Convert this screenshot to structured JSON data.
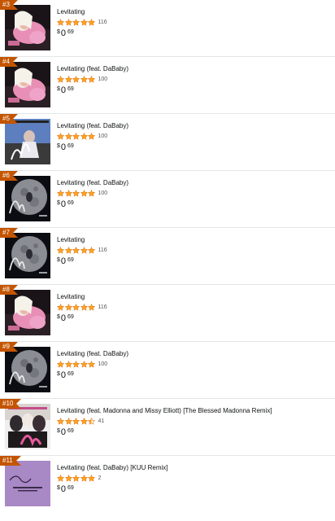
{
  "colors": {
    "rank_badge": "#c45500",
    "star": "#ffa41c",
    "star_stroke": "#de7921",
    "divider": "#e3e6e6"
  },
  "items": [
    {
      "rank": "#3",
      "title": "Levitating",
      "stars": 5,
      "reviews": "116",
      "currency": "$",
      "price_whole": "0",
      "price_fraction": "69",
      "cover": "pink"
    },
    {
      "rank": "#4",
      "title": "Levitating (feat. DaBaby)",
      "stars": 5,
      "reviews": "100",
      "currency": "$",
      "price_whole": "0",
      "price_fraction": "69",
      "cover": "pink"
    },
    {
      "rank": "#5",
      "title": "Levitating (feat. DaBaby)",
      "stars": 5,
      "reviews": "100",
      "currency": "$",
      "price_whole": "0",
      "price_fraction": "69",
      "cover": "script"
    },
    {
      "rank": "#6",
      "title": "Levitating (feat. DaBaby)",
      "stars": 5,
      "reviews": "100",
      "currency": "$",
      "price_whole": "0",
      "price_fraction": "69",
      "cover": "moon"
    },
    {
      "rank": "#7",
      "title": "Levitating",
      "stars": 5,
      "reviews": "116",
      "currency": "$",
      "price_whole": "0",
      "price_fraction": "69",
      "cover": "moon"
    },
    {
      "rank": "#8",
      "title": "Levitating",
      "stars": 5,
      "reviews": "116",
      "currency": "$",
      "price_whole": "0",
      "price_fraction": "69",
      "cover": "pink"
    },
    {
      "rank": "#9",
      "title": "Levitating (feat. DaBaby)",
      "stars": 5,
      "reviews": "100",
      "currency": "$",
      "price_whole": "0",
      "price_fraction": "69",
      "cover": "moon"
    },
    {
      "rank": "#10",
      "title": "Levitating (feat. Madonna and Missy Elliott) [The Blessed Madonna Remix]",
      "stars": 4.5,
      "reviews": "41",
      "currency": "$",
      "price_whole": "0",
      "price_fraction": "69",
      "cover": "club"
    },
    {
      "rank": "#11",
      "title": "Levitating (feat. DaBaby) [KUU Remix]",
      "stars": 5,
      "reviews": "2",
      "currency": "$",
      "price_whole": "0",
      "price_fraction": "69",
      "cover": "lilac"
    }
  ]
}
